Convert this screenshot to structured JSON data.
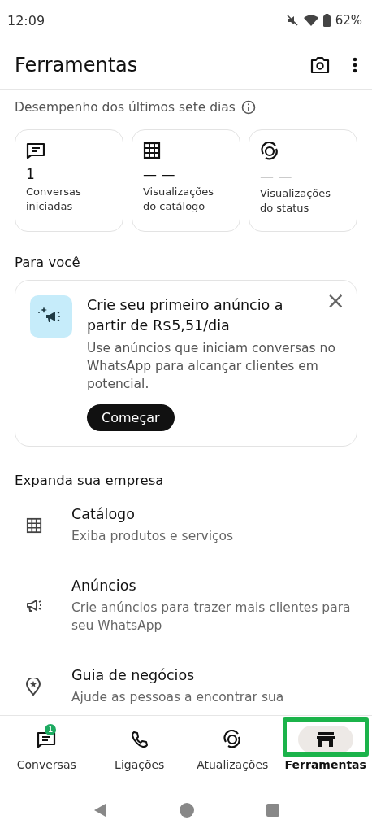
{
  "status_bar": {
    "time": "12:09",
    "battery": "62%"
  },
  "app_bar": {
    "title": "Ferramentas"
  },
  "performance": {
    "heading": "Desempenho dos últimos sete dias",
    "cards": [
      {
        "kind": "chat",
        "value": "1",
        "label": "Conversas iniciadas"
      },
      {
        "kind": "grid",
        "value": "— —",
        "label": "Visualizações do catálogo"
      },
      {
        "kind": "status",
        "value": "— —",
        "label": "Visualizações do status"
      }
    ]
  },
  "for_you": {
    "heading": "Para você",
    "promo": {
      "title": "Crie seu primeiro anúncio a partir de R$5,51/dia",
      "body": "Use anúncios que iniciam conversas no WhatsApp para alcançar clientes em potencial.",
      "button": "Começar",
      "close": "×"
    }
  },
  "expand": {
    "heading": "Expanda sua empresa",
    "items": [
      {
        "kind": "grid",
        "title": "Catálogo",
        "subtitle": "Exiba produtos e serviços"
      },
      {
        "kind": "megaphone",
        "title": "Anúncios",
        "subtitle": "Crie anúncios para trazer mais clientes para seu WhatsApp"
      },
      {
        "kind": "pin",
        "title": "Guia de negócios",
        "subtitle": "Ajude as pessoas a encontrar sua"
      }
    ]
  },
  "tabs": [
    {
      "kind": "chat",
      "label": "Conversas",
      "badge": "1",
      "selected": false,
      "highlighted": false
    },
    {
      "kind": "phone",
      "label": "Ligações",
      "selected": false,
      "highlighted": false
    },
    {
      "kind": "status",
      "label": "Atualizações",
      "selected": false,
      "highlighted": false
    },
    {
      "kind": "store",
      "label": "Ferramentas",
      "selected": true,
      "highlighted": true
    }
  ]
}
